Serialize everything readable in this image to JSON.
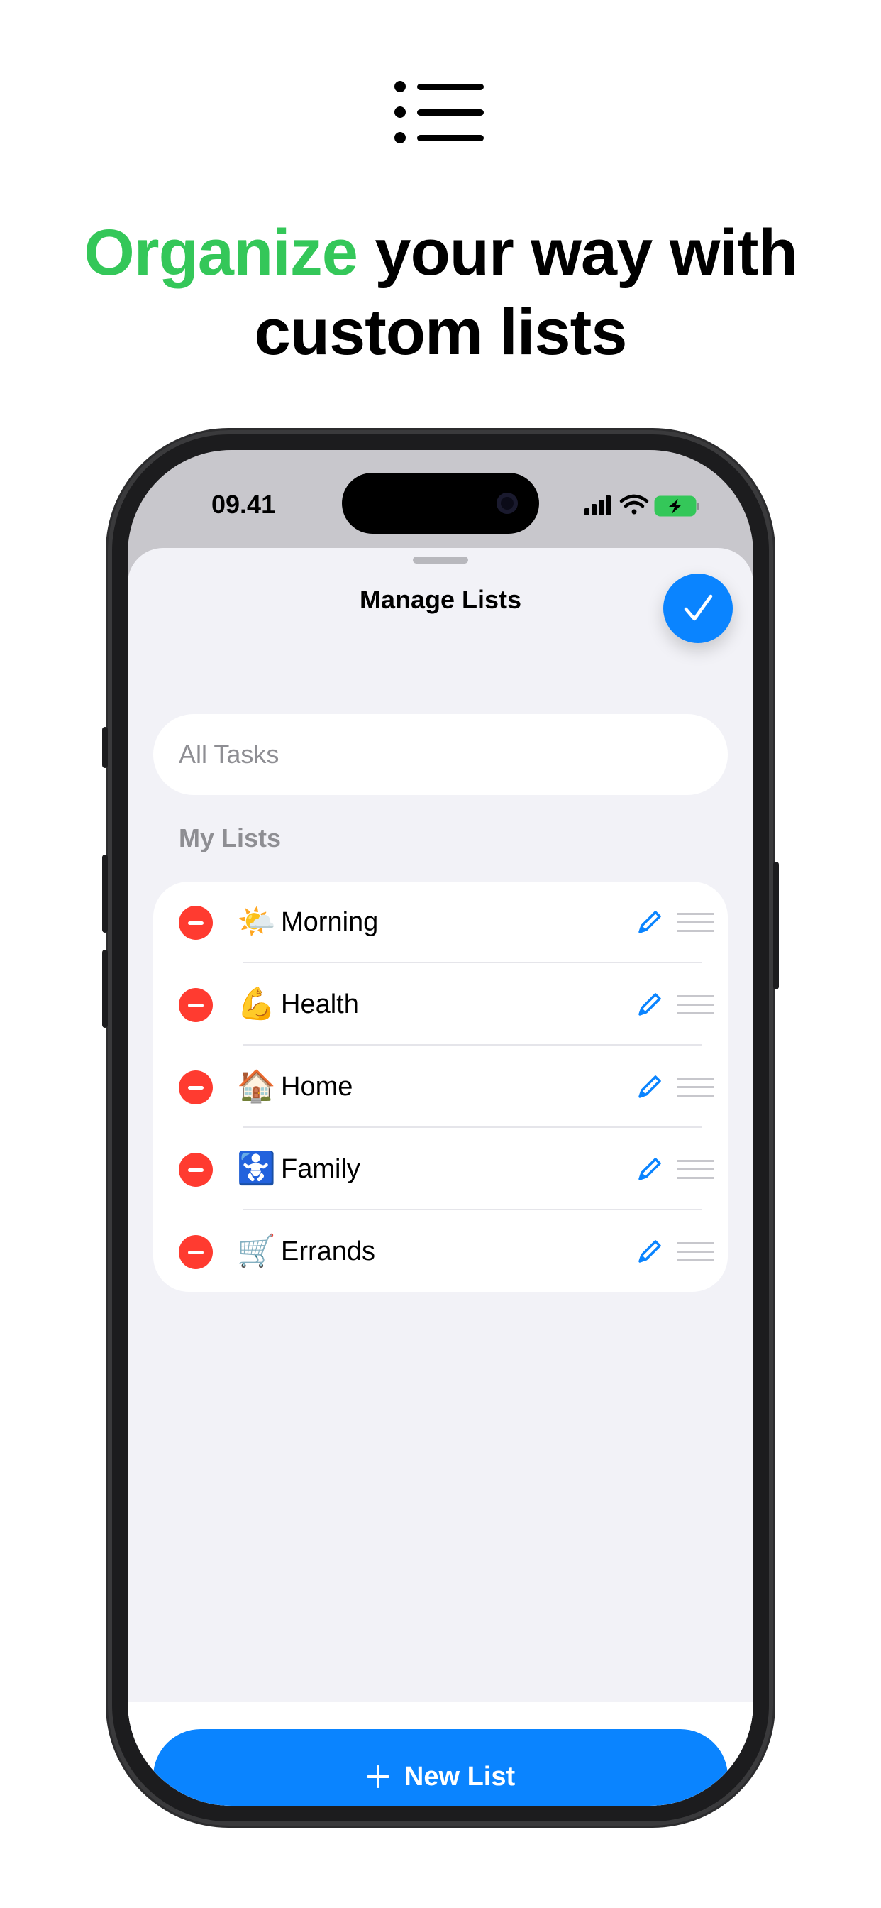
{
  "hero": {
    "icon": "list-bullet-icon",
    "headline_accent": "Organize",
    "headline_line1_rest": " your way with",
    "headline_line2": "custom lists",
    "accent_color": "#34c759"
  },
  "status_bar": {
    "time": "09.41",
    "icons": [
      "cellular-signal-icon",
      "wifi-icon",
      "battery-charging-icon"
    ]
  },
  "sheet": {
    "title": "Manage Lists",
    "done_icon": "checkmark-icon",
    "all_tasks_label": "All Tasks",
    "section_label": "My Lists",
    "lists": [
      {
        "emoji": "🌤️",
        "name": "Morning"
      },
      {
        "emoji": "💪",
        "name": "Health"
      },
      {
        "emoji": "🏠",
        "name": "Home"
      },
      {
        "emoji": "🚼",
        "name": "Family"
      },
      {
        "emoji": "🛒",
        "name": "Errands"
      }
    ],
    "new_list_label": "New List",
    "accent_blue": "#0a84ff",
    "delete_red": "#ff3b30"
  }
}
